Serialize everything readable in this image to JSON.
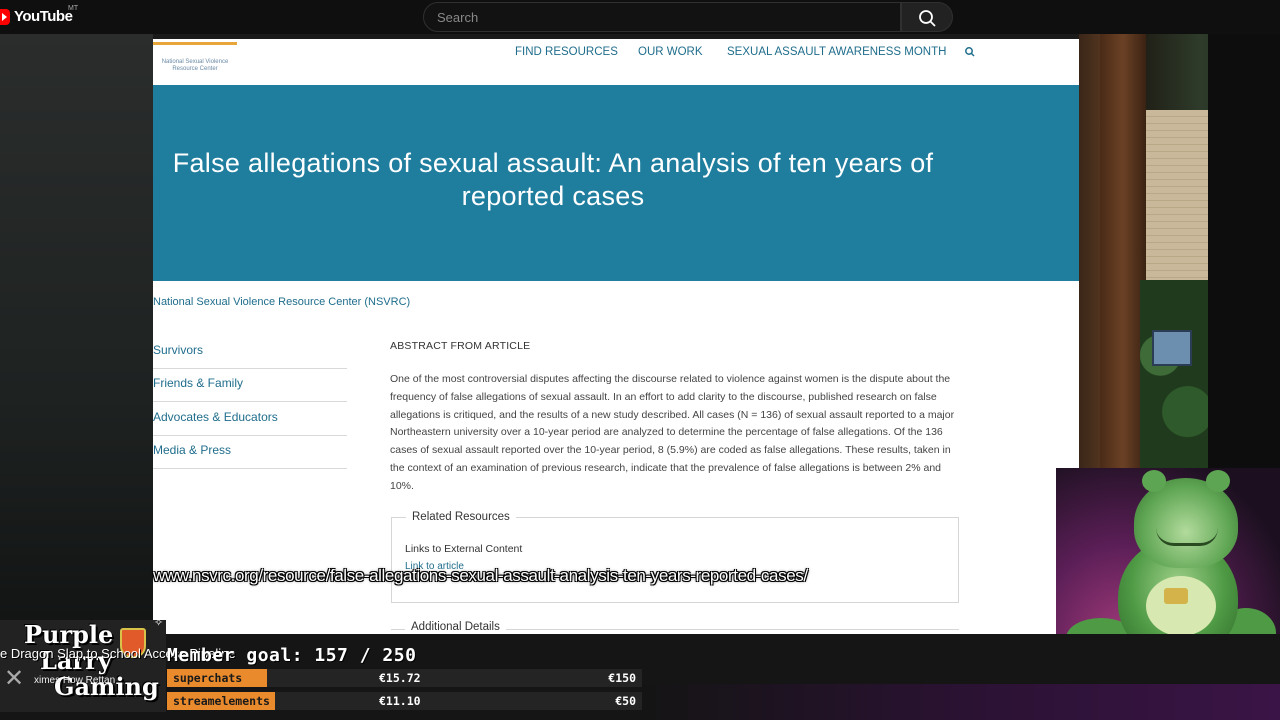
{
  "youtube": {
    "logo_text": "YouTube",
    "country_code": "MT",
    "search_placeholder": "Search"
  },
  "site": {
    "logo_text": "National Sexual Violence Resource Center",
    "nav": [
      "FIND RESOURCES",
      "OUR WORK",
      "SEXUAL ASSAULT AWARENESS MONTH"
    ],
    "nav_search_icon": "search-icon"
  },
  "article": {
    "title": "False allegations of sexual assault: An analysis of ten years of reported cases",
    "organization": "National Sexual Violence Resource Center (NSVRC)",
    "sidebar": [
      "Survivors",
      "Friends & Family",
      "Advocates & Educators",
      "Media & Press"
    ],
    "abstract_heading": "ABSTRACT FROM ARTICLE",
    "abstract_body": "One of the most controversial disputes affecting the discourse related to violence against women is the dispute about the frequency of false allegations of sexual assault. In an effort to add clarity to the discourse, published research on false allegations is critiqued, and the results of a new study described. All cases (N = 136) of sexual assault reported to a major Northeastern university over a 10-year period are analyzed to determine the percentage of false allegations. Of the 136 cases of sexual assault reported over the 10-year period, 8 (5.9%) are coded as false allegations. These results, taken in the context of an examination of previous research, indicate that the prevalence of false allegations is between 2% and 10%.",
    "related_resources": {
      "legend": "Related Resources",
      "subheading": "Links to External Content",
      "link": "Link to article"
    },
    "additional_details": "Additional Details"
  },
  "overlay": {
    "url_caption": "www.nsvrc.org/resource/false-allegations-sexual-assault-analysis-ten-years-reported-cases/",
    "ticker_text": "e Dragon Slap to School Access Pipeline",
    "ticker_sub": "ximes How Rettan",
    "channel_logo": [
      "Purple",
      "Larry",
      "Gaming"
    ],
    "member_goal": "Member goal:  157 / 250",
    "donations": [
      {
        "label": "superchats",
        "value": "€15.72",
        "goal": "€150"
      },
      {
        "label": "streamelements",
        "value": "€11.10",
        "goal": "€50"
      }
    ]
  },
  "colors": {
    "hero": "#1f7d9e",
    "link": "#1f6d8c",
    "donation_tag": "#e98a2c",
    "youtube_red": "#ff0000"
  }
}
